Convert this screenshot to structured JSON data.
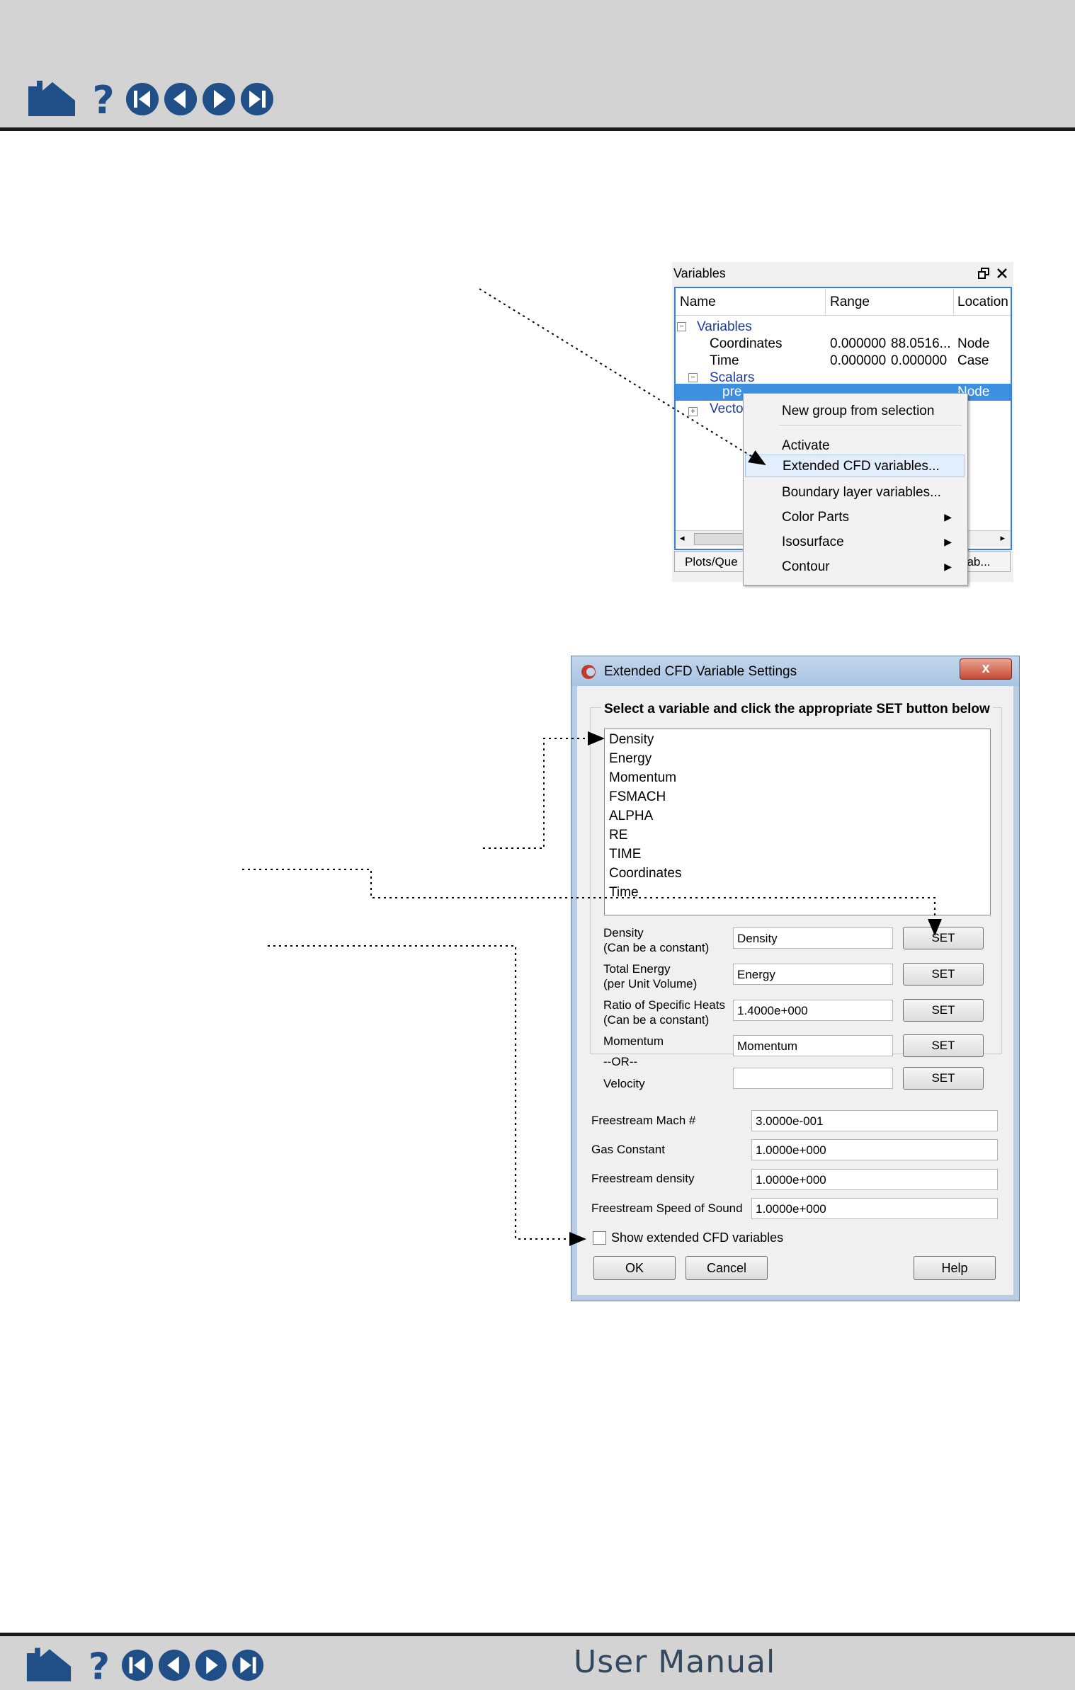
{
  "footer": {
    "title": "User Manual"
  },
  "variables_panel": {
    "title": "Variables",
    "columns": [
      "Name",
      "Range",
      "Location"
    ],
    "rows": [
      {
        "name": "Variables",
        "range_min": "",
        "range_max": "",
        "location": ""
      },
      {
        "name": "Coordinates",
        "range_min": "0.000000",
        "range_max": "88.0516...",
        "location": "Node"
      },
      {
        "name": "Time",
        "range_min": "0.000000",
        "range_max": "0.000000",
        "location": "Case"
      },
      {
        "name": "Scalars",
        "range_min": "",
        "range_max": "",
        "location": ""
      },
      {
        "name": "pre",
        "range_min": "",
        "range_max": "",
        "location": "Node"
      },
      {
        "name": "Vecto",
        "range_min": "",
        "range_max": "",
        "location": ""
      }
    ],
    "tabs": [
      "Plots/Que",
      "riab..."
    ],
    "context_menu": [
      {
        "label": "New group from selection",
        "submenu": false
      },
      {
        "label": "Activate",
        "submenu": false
      },
      {
        "label": "Extended CFD variables...",
        "submenu": false,
        "highlighted": true
      },
      {
        "label": "Boundary layer variables...",
        "submenu": false
      },
      {
        "label": "Color Parts",
        "submenu": true
      },
      {
        "label": "Isosurface",
        "submenu": true
      },
      {
        "label": "Contour",
        "submenu": true
      }
    ]
  },
  "dialog": {
    "title": "Extended CFD Variable Settings",
    "close_label": "x",
    "heading": "Select a variable and click the appropriate SET button below",
    "variable_list": [
      "Density",
      "Energy",
      "Momentum",
      "FSMACH",
      "ALPHA",
      "RE",
      "TIME",
      "Coordinates",
      "Time"
    ],
    "set_fields": [
      {
        "label1": "Density",
        "label2": "(Can be a constant)",
        "value": "Density",
        "button": "SET"
      },
      {
        "label1": "Total Energy",
        "label2": "(per Unit Volume)",
        "value": "Energy",
        "button": "SET"
      },
      {
        "label1": "Ratio of Specific Heats",
        "label2": "(Can be a constant)",
        "value": "1.4000e+000",
        "button": "SET"
      },
      {
        "label1": "Momentum",
        "label2": "",
        "value": "Momentum",
        "button": "SET"
      },
      {
        "label1": "Velocity",
        "label2": "",
        "value": "",
        "button": "SET"
      }
    ],
    "or_label": "--OR--",
    "freestream": [
      {
        "label": "Freestream Mach #",
        "value": "3.0000e-001"
      },
      {
        "label": "Gas Constant",
        "value": "1.0000e+000"
      },
      {
        "label": "Freestream density",
        "value": "1.0000e+000"
      },
      {
        "label": "Freestream Speed of Sound",
        "value": "1.0000e+000"
      }
    ],
    "checkbox_label": "Show extended CFD variables",
    "checkbox_checked": false,
    "ok_label": "OK",
    "cancel_label": "Cancel",
    "help_label": "Help"
  },
  "colors": {
    "nav_blue": "#1f4f86",
    "selection": "#3d8fe0",
    "tree_text": "#1a3aa3"
  }
}
